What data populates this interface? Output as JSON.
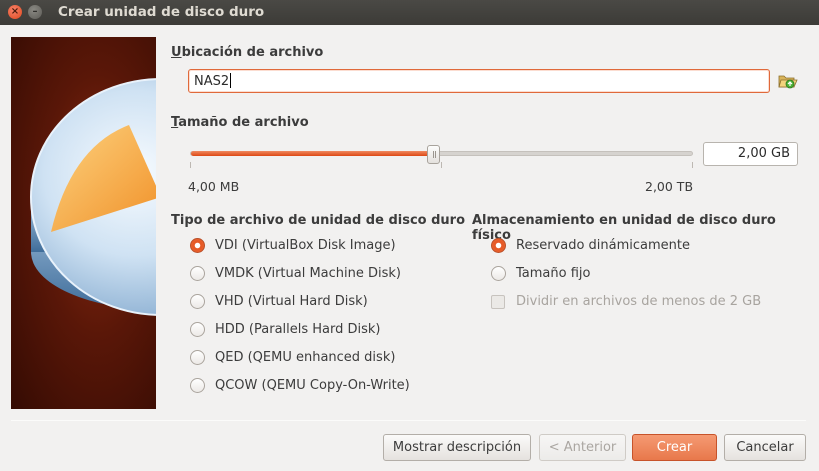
{
  "window": {
    "title": "Crear unidad de disco duro"
  },
  "file_location": {
    "heading_pre": "",
    "heading_mnemonic": "U",
    "heading_post": "bicación de archivo",
    "value": "NAS2"
  },
  "file_size": {
    "heading_pre": "",
    "heading_mnemonic": "T",
    "heading_post": "amaño de archivo",
    "value": "2,00 GB",
    "min_label": "4,00 MB",
    "max_label": "2,00 TB",
    "slider_fraction": 0.473
  },
  "file_type": {
    "heading": "Tipo de archivo de unidad de disco duro",
    "options": [
      {
        "label": "VDI (VirtualBox Disk Image)",
        "checked": true
      },
      {
        "label": "VMDK (Virtual Machine Disk)",
        "checked": false
      },
      {
        "label": "VHD (Virtual Hard Disk)",
        "checked": false
      },
      {
        "label": "HDD (Parallels Hard Disk)",
        "checked": false
      },
      {
        "label": "QED (QEMU enhanced disk)",
        "checked": false
      },
      {
        "label": "QCOW (QEMU Copy-On-Write)",
        "checked": false
      }
    ]
  },
  "storage": {
    "heading": "Almacenamiento en unidad de disco duro físico",
    "dynamic_label": "Reservado dinámicamente",
    "fixed_label": "Tamaño fijo",
    "split_label": "Dividir en archivos de menos de 2 GB",
    "selected": "dynamic"
  },
  "buttons": {
    "description": "Mostrar descripción",
    "back": "< Anterior",
    "create": "Crear",
    "cancel": "Cancelar"
  },
  "colors": {
    "accent": "#e8784b",
    "focus_border": "#e0693a",
    "slider_fill": "#dd4814"
  },
  "icons": {
    "folder": "folder-open-icon",
    "close": "close-icon",
    "minimize": "minimize-icon"
  }
}
